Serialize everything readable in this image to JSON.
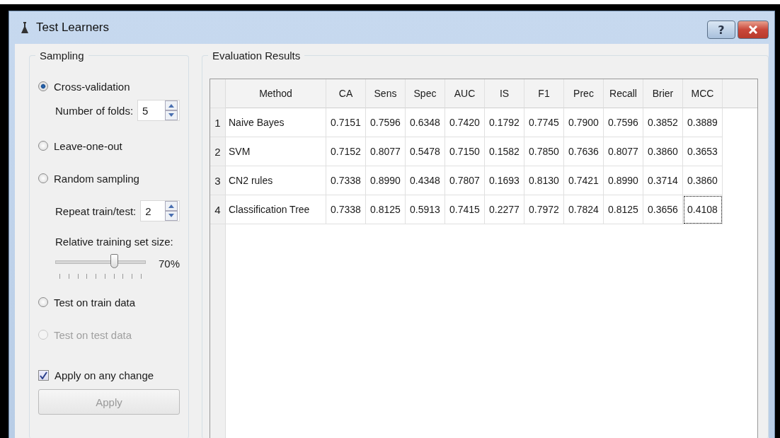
{
  "window": {
    "title": "Test Learners",
    "help_button": "?"
  },
  "sampling": {
    "title": "Sampling",
    "options": [
      {
        "label": "Cross-validation",
        "selected": true,
        "disabled": false,
        "controls": [
          {
            "kind": "spin",
            "label": "Number of folds:",
            "value": "5"
          }
        ]
      },
      {
        "label": "Leave-one-out",
        "selected": false,
        "disabled": false
      },
      {
        "label": "Random sampling",
        "selected": false,
        "disabled": false,
        "controls": [
          {
            "kind": "spin",
            "label": "Repeat train/test:",
            "value": "2"
          },
          {
            "kind": "slider",
            "label": "Relative training set size:",
            "level": 0.65,
            "reading": "70%"
          }
        ]
      },
      {
        "label": "Test on train data",
        "selected": false,
        "disabled": false
      },
      {
        "label": "Test on test data",
        "selected": false,
        "disabled": true
      }
    ],
    "apply_on_change": {
      "label": "Apply on any change",
      "checked": true
    },
    "apply_button": {
      "label": "Apply",
      "disabled": true
    }
  },
  "results": {
    "title": "Evaluation Results",
    "table": {
      "columns": [
        "Method",
        "CA",
        "Sens",
        "Spec",
        "AUC",
        "IS",
        "F1",
        "Prec",
        "Recall",
        "Brier",
        "MCC"
      ],
      "rows": [
        {
          "number": "1",
          "focused": false,
          "cells": [
            "Naive Bayes",
            "0.7151",
            "0.7596",
            "0.6348",
            "0.7420",
            "0.1792",
            "0.7745",
            "0.7900",
            "0.7596",
            "0.3852",
            "0.3889"
          ]
        },
        {
          "number": "2",
          "focused": false,
          "cells": [
            "SVM",
            "0.7152",
            "0.8077",
            "0.5478",
            "0.7150",
            "0.1582",
            "0.7850",
            "0.7636",
            "0.8077",
            "0.3860",
            "0.3653"
          ]
        },
        {
          "number": "3",
          "focused": false,
          "cells": [
            "CN2 rules",
            "0.7338",
            "0.8990",
            "0.4348",
            "0.7807",
            "0.1693",
            "0.8130",
            "0.7421",
            "0.8990",
            "0.3714",
            "0.3860"
          ]
        },
        {
          "number": "4",
          "focused": true,
          "cells": [
            "Classification Tree",
            "0.7338",
            "0.8125",
            "0.5913",
            "0.7415",
            "0.2277",
            "0.7972",
            "0.7824",
            "0.8125",
            "0.3656",
            "0.4108"
          ]
        }
      ]
    }
  }
}
